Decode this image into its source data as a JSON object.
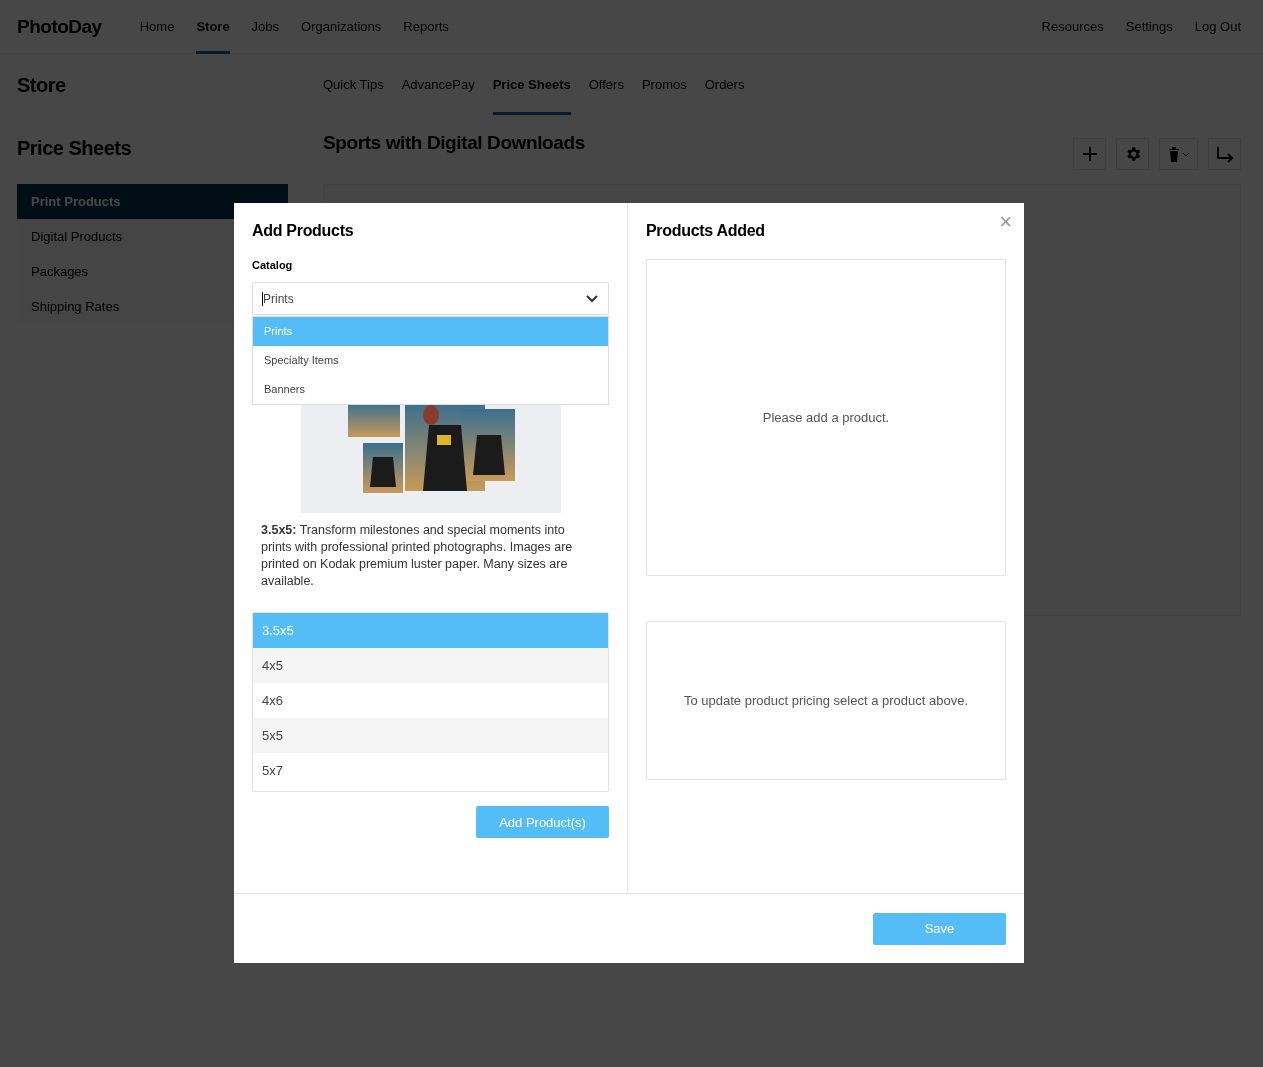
{
  "header": {
    "logo": "PhotoDay",
    "nav": [
      {
        "label": "Home",
        "selected": false
      },
      {
        "label": "Store",
        "selected": true
      },
      {
        "label": "Jobs",
        "selected": false
      },
      {
        "label": "Organizations",
        "selected": false
      },
      {
        "label": "Reports",
        "selected": false
      }
    ],
    "right_nav": [
      "Resources",
      "Settings",
      "Log Out"
    ]
  },
  "sidebar": {
    "title": "Store",
    "section_title": "Price Sheets",
    "items": [
      {
        "label": "Print Products",
        "selected": true
      },
      {
        "label": "Digital Products",
        "selected": false
      },
      {
        "label": "Packages",
        "selected": false
      },
      {
        "label": "Shipping Rates",
        "selected": false
      }
    ]
  },
  "subnav": [
    {
      "label": "Quick Tips",
      "selected": false
    },
    {
      "label": "AdvancePay",
      "selected": false
    },
    {
      "label": "Price Sheets",
      "selected": true
    },
    {
      "label": "Offers",
      "selected": false
    },
    {
      "label": "Promos",
      "selected": false
    },
    {
      "label": "Orders",
      "selected": false
    }
  ],
  "page_title": "Sports with Digital Downloads",
  "modal": {
    "left_title": "Add Products",
    "catalog_label": "Catalog",
    "catalog_value": "Prints",
    "catalog_options": [
      {
        "label": "Prints",
        "selected": true
      },
      {
        "label": "Specialty Items",
        "selected": false
      },
      {
        "label": "Banners",
        "selected": false
      }
    ],
    "product_description": "**3.5x5:** Transform milestones and special moments into prints with professional printed photographs. Images are printed on Kodak premium luster paper. Many sizes are available.",
    "products": [
      {
        "label": "3.5x5",
        "selected": true
      },
      {
        "label": "4x5",
        "selected": false
      },
      {
        "label": "4x6",
        "selected": false
      },
      {
        "label": "5x5",
        "selected": false
      },
      {
        "label": "5x7",
        "selected": false
      }
    ],
    "add_button": "Add Product(s)",
    "right_title": "Products Added",
    "added_empty": "Please add a product.",
    "pricing_empty": "To update product pricing select a product above.",
    "close": "×",
    "save_button": "Save"
  }
}
